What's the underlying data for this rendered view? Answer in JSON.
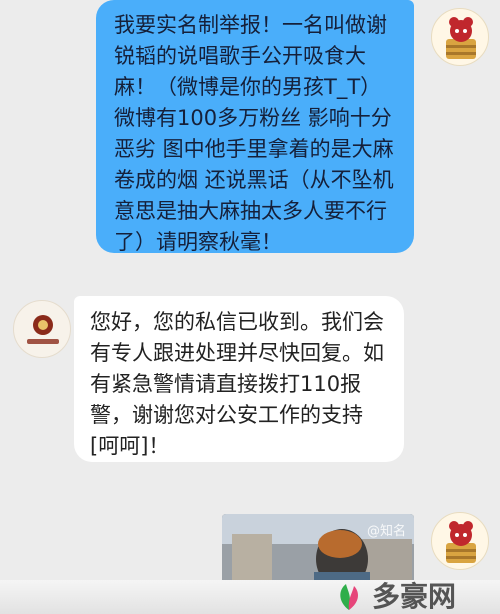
{
  "messages": [
    {
      "side": "outgoing",
      "sender": "user",
      "text": "我要实名制举报！一名叫做谢锐韬的说唱歌手公开吸食大麻！（微博是你的男孩T_T）微博有100多万粉丝 影响十分恶劣 图中他手里拿着的是大麻卷成的烟 还说黑话（从不坠机 意思是抽大麻抽太多人要不行了）请明察秋毫！"
    },
    {
      "side": "incoming",
      "sender": "police",
      "text": "您好，您的私信已收到。我们会有专人跟进处理并尽快回复。如有紧急警情请直接拨打110报警，谢谢您对公安工作的支持[呵呵]！"
    },
    {
      "side": "outgoing",
      "sender": "user",
      "type": "image",
      "overlay_text": "@知名"
    }
  ],
  "avatars": {
    "user": {
      "icon": "cartoon-figure-avatar-icon",
      "color": "#c0272d"
    },
    "police": {
      "icon": "police-badge-avatar-icon",
      "color": "#8a2a1a"
    }
  },
  "colors": {
    "outgoing_bubble": "#4aaefa",
    "incoming_bubble": "#ffffff",
    "background": "#ececec"
  },
  "watermark": {
    "text": "多豪网",
    "icon": "leaf-logo-icon"
  }
}
